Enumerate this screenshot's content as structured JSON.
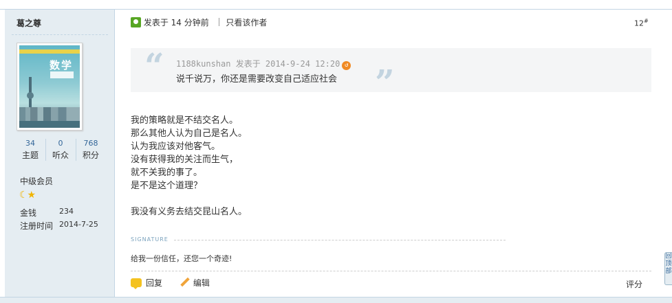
{
  "author": {
    "name": "葛之尊",
    "stats": [
      {
        "value": "34",
        "label": "主题"
      },
      {
        "value": "0",
        "label": "听众"
      },
      {
        "value": "768",
        "label": "积分"
      }
    ],
    "group": "中级会员",
    "money_label": "金钱",
    "money_value": "234",
    "reg_label": "注册时间",
    "reg_value": "2014-7-25",
    "avatar_title": "数学"
  },
  "post": {
    "posted_prefix": "发表于",
    "posted_time": "14 分钟前",
    "only_author": "只看该作者",
    "floor": "12",
    "floor_sup": "#",
    "quote": {
      "meta": "1188kunshan 发表于 2014-9-24 12:20",
      "text": "说千说万，你还是需要改变自己适应社会"
    },
    "lines": [
      "我的策略就是不结交名人。",
      "那么其他人认为自己是名人。",
      "认为我应该对他客气。",
      "没有获得我的关注而生气，",
      "就不关我的事了。",
      "是不是这个道理？"
    ],
    "last_line": "我没有义务去结交昆山名人。",
    "signature_label": "SIGNATURE",
    "signature": "给我一份信任，还您一个奇迹!"
  },
  "actions": {
    "reply": "回复",
    "edit": "编辑",
    "rate": "评分"
  },
  "side_tab": "回顶部"
}
